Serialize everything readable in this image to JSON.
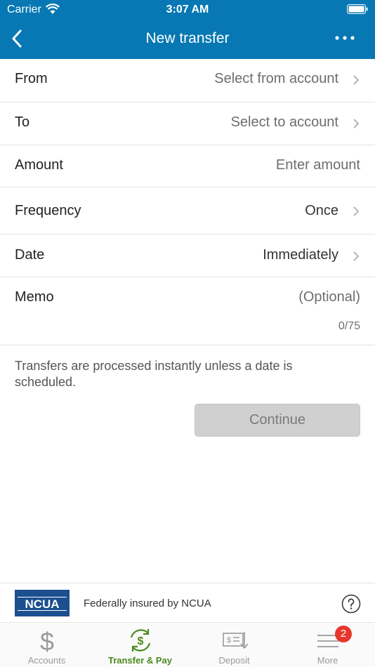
{
  "status_bar": {
    "carrier": "Carrier",
    "time": "3:07 AM"
  },
  "header": {
    "title": "New transfer",
    "back_icon": "chevron-left-icon",
    "more_icon": "ellipsis-icon"
  },
  "form": {
    "from": {
      "label": "From",
      "value": "Select from account"
    },
    "to": {
      "label": "To",
      "value": "Select to account"
    },
    "amount": {
      "label": "Amount",
      "placeholder": "Enter amount"
    },
    "frequency": {
      "label": "Frequency",
      "value": "Once"
    },
    "date": {
      "label": "Date",
      "value": "Immediately"
    },
    "memo": {
      "label": "Memo",
      "placeholder": "(Optional)",
      "counter": "0/75"
    }
  },
  "note": "Transfers are processed instantly unless a date is scheduled.",
  "continue_label": "Continue",
  "insurance": {
    "logo_text": "NCUA",
    "text": "Federally insured by NCUA"
  },
  "tabs": [
    {
      "label": "Accounts",
      "icon": "dollar-icon"
    },
    {
      "label": "Transfer & Pay",
      "icon": "transfer-pay-icon",
      "active": true
    },
    {
      "label": "Deposit",
      "icon": "check-deposit-icon"
    },
    {
      "label": "More",
      "icon": "menu-icon",
      "badge": "2"
    }
  ],
  "colors": {
    "header": "#0778b3",
    "active_tab": "#4a8a1c",
    "badge": "#e8362a"
  }
}
